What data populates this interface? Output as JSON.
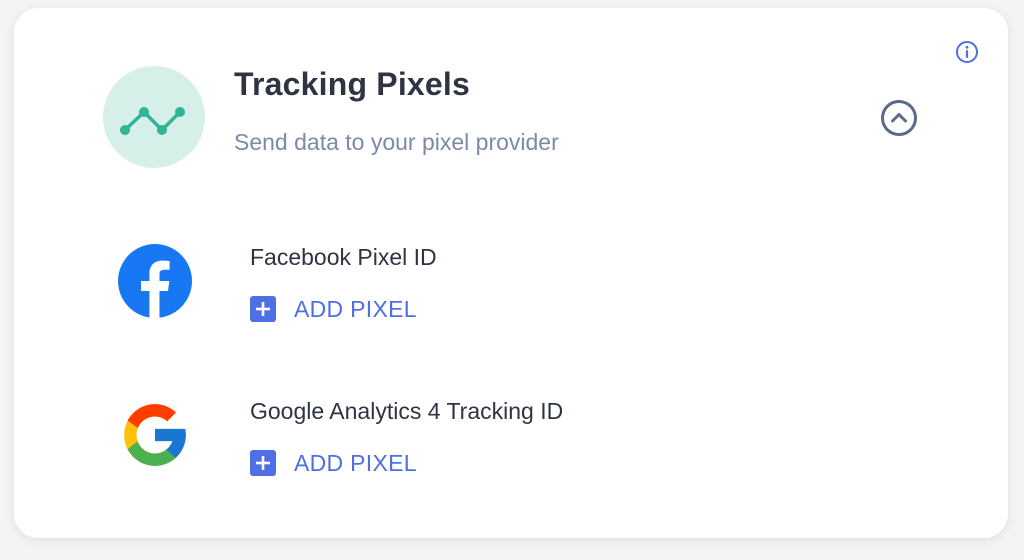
{
  "header": {
    "title": "Tracking Pixels",
    "subtitle": "Send data to your pixel provider",
    "icon": "trend-line-icon",
    "icon_color": "#2fb596",
    "icon_bg": "#d7efe9"
  },
  "controls": {
    "info_icon": "info-icon",
    "collapse_icon": "chevron-up-circle-icon"
  },
  "providers": [
    {
      "label": "Facebook Pixel ID",
      "icon": "facebook-logo-icon",
      "action_label": "ADD PIXEL"
    },
    {
      "label": "Google Analytics 4 Tracking ID",
      "icon": "google-logo-icon",
      "action_label": "ADD PIXEL"
    }
  ],
  "colors": {
    "accent": "#4f6fe4",
    "title_text": "#2f3443",
    "subtitle_text": "#7b8aa6",
    "facebook_blue": "#1877f2"
  }
}
